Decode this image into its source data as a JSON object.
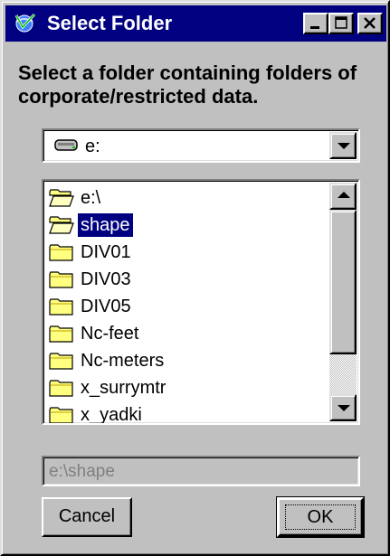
{
  "window": {
    "title": "Select Folder",
    "title_icon": "globe-check-icon"
  },
  "titlebar_buttons": {
    "minimize_icon": "minimize-icon",
    "maximize_icon": "maximize-icon",
    "close_icon": "close-icon"
  },
  "instruction": "Select a folder containing folders of corporate/restricted data.",
  "drive": {
    "selected": "e:",
    "icon": "drive-icon"
  },
  "tree": {
    "items": [
      {
        "label": "e:\\",
        "icon": "open-folder-icon",
        "selected": false
      },
      {
        "label": "shape",
        "icon": "open-folder-icon",
        "selected": true
      },
      {
        "label": "DIV01",
        "icon": "folder-icon",
        "selected": false
      },
      {
        "label": "DIV03",
        "icon": "folder-icon",
        "selected": false
      },
      {
        "label": "DIV05",
        "icon": "folder-icon",
        "selected": false
      },
      {
        "label": "Nc-feet",
        "icon": "folder-icon",
        "selected": false
      },
      {
        "label": "Nc-meters",
        "icon": "folder-icon",
        "selected": false
      },
      {
        "label": "x_surrymtr",
        "icon": "folder-icon",
        "selected": false
      },
      {
        "label": "x_yadki",
        "icon": "folder-icon",
        "selected": false
      }
    ]
  },
  "path_value": "e:\\shape",
  "buttons": {
    "cancel": "Cancel",
    "ok": "OK"
  },
  "colors": {
    "title_bar": "#000080",
    "selection": "#000080",
    "face": "#c0c0c0"
  }
}
